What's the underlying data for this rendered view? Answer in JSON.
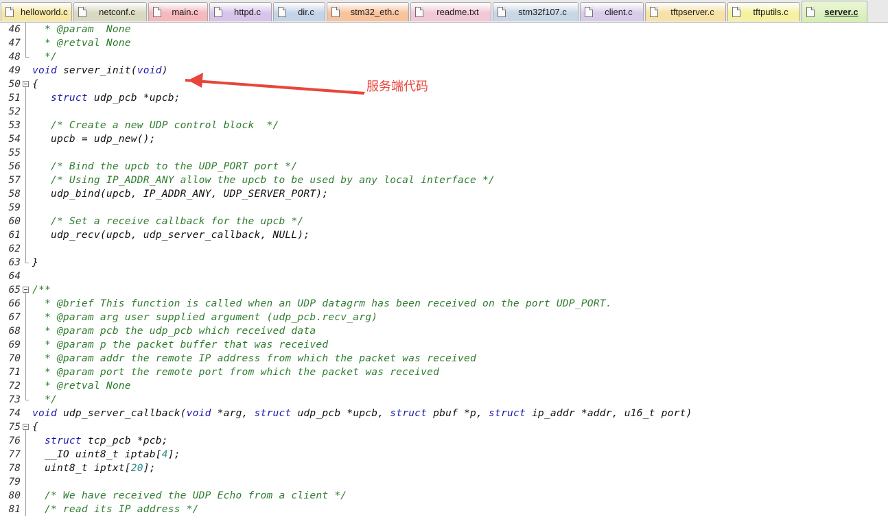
{
  "tabs": [
    {
      "label": "helloworld.c",
      "color": "#f7e7a4",
      "icon": "document-icon",
      "active": false
    },
    {
      "label": "netconf.c",
      "color": "#d9d9c2",
      "icon": "document-icon",
      "active": false
    },
    {
      "label": "main.c",
      "color": "#f5b8bd",
      "icon": "document-icon",
      "active": false
    },
    {
      "label": "httpd.c",
      "color": "#d8c4ea",
      "icon": "document-icon",
      "active": false
    },
    {
      "label": "dir.c",
      "color": "#c4d4e8",
      "icon": "document-icon",
      "active": false
    },
    {
      "label": "stm32_eth.c",
      "color": "#f8c29d",
      "icon": "document-lock-icon",
      "active": false
    },
    {
      "label": "readme.txt",
      "color": "#f1c8d6",
      "icon": "document-icon",
      "active": false
    },
    {
      "label": "stm32f107.c",
      "color": "#c9d6e6",
      "icon": "document-icon",
      "active": false
    },
    {
      "label": "client.c",
      "color": "#d8ccea",
      "icon": "document-icon",
      "active": false
    },
    {
      "label": "tftpserver.c",
      "color": "#f6e1a6",
      "icon": "document-icon",
      "active": false
    },
    {
      "label": "tftputils.c",
      "color": "#f4f1a0",
      "icon": "document-icon",
      "active": false
    },
    {
      "label": "server.c",
      "color": "#d4edb3",
      "icon": "document-icon",
      "active": true
    }
  ],
  "code_lines": [
    {
      "num": "46",
      "text": "  * @param  None",
      "kind": "comment",
      "fold": "vline"
    },
    {
      "num": "47",
      "text": "  * @retval None",
      "kind": "comment",
      "fold": "vline"
    },
    {
      "num": "48",
      "text": "  */",
      "kind": "comment",
      "fold": "end"
    },
    {
      "num": "49",
      "text": "void server_init(void)",
      "kind": "mixed",
      "fold": "none"
    },
    {
      "num": "50",
      "text": "{",
      "kind": "normal",
      "fold": "box"
    },
    {
      "num": "51",
      "text": "   struct udp_pcb *upcb;",
      "kind": "mixed",
      "fold": "vline"
    },
    {
      "num": "52",
      "text": "",
      "kind": "normal",
      "fold": "vline"
    },
    {
      "num": "53",
      "text": "   /* Create a new UDP control block  */",
      "kind": "comment",
      "fold": "vline"
    },
    {
      "num": "54",
      "text": "   upcb = udp_new();",
      "kind": "normal",
      "fold": "vline"
    },
    {
      "num": "55",
      "text": "",
      "kind": "normal",
      "fold": "vline"
    },
    {
      "num": "56",
      "text": "   /* Bind the upcb to the UDP_PORT port */",
      "kind": "comment",
      "fold": "vline"
    },
    {
      "num": "57",
      "text": "   /* Using IP_ADDR_ANY allow the upcb to be used by any local interface */",
      "kind": "comment",
      "fold": "vline"
    },
    {
      "num": "58",
      "text": "   udp_bind(upcb, IP_ADDR_ANY, UDP_SERVER_PORT);",
      "kind": "normal",
      "fold": "vline"
    },
    {
      "num": "59",
      "text": "",
      "kind": "normal",
      "fold": "vline"
    },
    {
      "num": "60",
      "text": "   /* Set a receive callback for the upcb */",
      "kind": "comment",
      "fold": "vline"
    },
    {
      "num": "61",
      "text": "   udp_recv(upcb, udp_server_callback, NULL);",
      "kind": "normal",
      "fold": "vline"
    },
    {
      "num": "62",
      "text": "",
      "kind": "normal",
      "fold": "vline"
    },
    {
      "num": "63",
      "text": "}",
      "kind": "normal",
      "fold": "end"
    },
    {
      "num": "64",
      "text": "",
      "kind": "normal",
      "fold": "none"
    },
    {
      "num": "65",
      "text": "/**",
      "kind": "comment",
      "fold": "box"
    },
    {
      "num": "66",
      "text": "  * @brief This function is called when an UDP datagrm has been received on the port UDP_PORT.",
      "kind": "comment",
      "fold": "vline"
    },
    {
      "num": "67",
      "text": "  * @param arg user supplied argument (udp_pcb.recv_arg)",
      "kind": "comment",
      "fold": "vline"
    },
    {
      "num": "68",
      "text": "  * @param pcb the udp_pcb which received data",
      "kind": "comment",
      "fold": "vline"
    },
    {
      "num": "69",
      "text": "  * @param p the packet buffer that was received",
      "kind": "comment",
      "fold": "vline"
    },
    {
      "num": "70",
      "text": "  * @param addr the remote IP address from which the packet was received",
      "kind": "comment",
      "fold": "vline"
    },
    {
      "num": "71",
      "text": "  * @param port the remote port from which the packet was received",
      "kind": "comment",
      "fold": "vline"
    },
    {
      "num": "72",
      "text": "  * @retval None",
      "kind": "comment",
      "fold": "vline"
    },
    {
      "num": "73",
      "text": "  */",
      "kind": "comment",
      "fold": "end"
    },
    {
      "num": "74",
      "text": "void udp_server_callback(void *arg, struct udp_pcb *upcb, struct pbuf *p, struct ip_addr *addr, u16_t port)",
      "kind": "mixed",
      "fold": "none"
    },
    {
      "num": "75",
      "text": "{",
      "kind": "normal",
      "fold": "box"
    },
    {
      "num": "76",
      "text": "  struct tcp_pcb *pcb;",
      "kind": "mixed",
      "fold": "vline"
    },
    {
      "num": "77",
      "text": "  __IO uint8_t iptab[4];",
      "kind": "mixed",
      "fold": "vline"
    },
    {
      "num": "78",
      "text": "  uint8_t iptxt[20];",
      "kind": "mixed",
      "fold": "vline"
    },
    {
      "num": "79",
      "text": "",
      "kind": "normal",
      "fold": "vline"
    },
    {
      "num": "80",
      "text": "  /* We have received the UDP Echo from a client */",
      "kind": "comment",
      "fold": "vline"
    },
    {
      "num": "81",
      "text": "  /* read its IP address */",
      "kind": "comment",
      "fold": "vline"
    }
  ],
  "annotation": {
    "text": "服务端代码",
    "color": "#e8463b"
  },
  "colors": {
    "comment": "#2f7d2f",
    "keyword": "#1a1aa8",
    "number": "#2d8c8c",
    "normal": "#111111"
  }
}
